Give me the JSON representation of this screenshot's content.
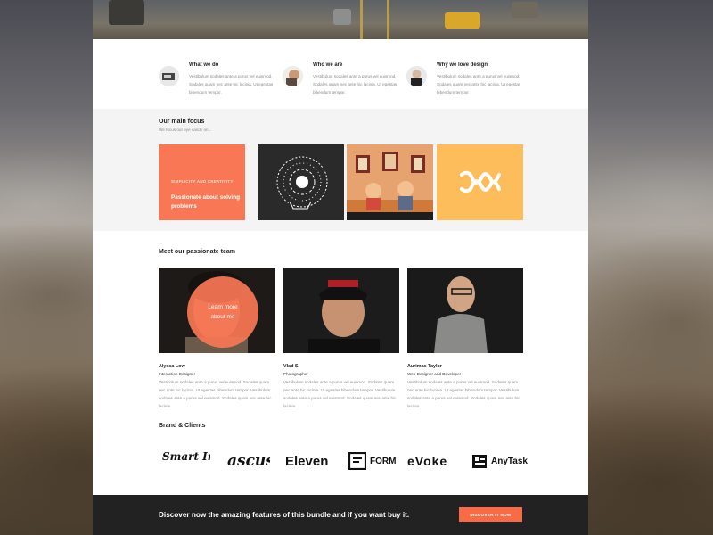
{
  "features": [
    {
      "title": "What we do",
      "text": "Vestibulum sodales ante a purus vel euismod. Sodales quam nec ante hic lacinia. Ut egestas bibendum tempor."
    },
    {
      "title": "Who we are",
      "text": "Vestibulum sodales ante a purus vel euismod. Sodales quam nec ante hic lacinia. Ut egestas bibendum tempor."
    },
    {
      "title": "Why we love design",
      "text": "Vestibulum sodales ante a purus vel euismod. Sodales quam nec ante hic lacinia. Ut egestas bibendum tempor."
    }
  ],
  "focus": {
    "title": "Our main focus",
    "subtitle": "We focus our eye candy on...",
    "tile_kicker": "SIMPLICITY AND CREATIVITY",
    "tile_headline": "Passionate about solving problems"
  },
  "team": {
    "title": "Meet our passionate team",
    "learn_more": "Learn more about me",
    "members": [
      {
        "name": "Alyssa Low",
        "role": "Interaction Designer",
        "bio": "Vestibulum sodales ante a purus vel euismod. Sodales quam nec ante hic lacinia. Ut egestas bibendum tempor. Vestibulum sodales ante a purus vel euismod. Sodales quam nec ante hic lacinia."
      },
      {
        "name": "Vlad S.",
        "role": "Photographer",
        "bio": "Vestibulum sodales ante a purus vel euismod. Sodales quam nec ante hic lacinia. Ut egestas bibendum tempor. Vestibulum sodales ante a purus vel euismod. Sodales quam nec ante hic lacinia."
      },
      {
        "name": "Aurimas Taylor",
        "role": "Web Designer and Developer",
        "bio": "Vestibulum sodales ante a purus vel euismod. Sodales quam nec ante hic lacinia. Ut egestas bibendum tempor. Vestibulum sodales ante a purus vel euismod. Sodales quam nec ante hic lacinia."
      }
    ]
  },
  "brands": {
    "title": "Brand & Clients",
    "logos": [
      "Smart Image",
      "ascus",
      "Eleven",
      "FORM",
      "eVoke",
      "AnyTask"
    ]
  },
  "cta": {
    "text": "Discover now the amazing features of this bundle and if you want buy it.",
    "button": "DISCOVER IT NOW"
  },
  "colors": {
    "accent": "#fa7755",
    "yellow": "#fdbd5a",
    "dark": "#222222"
  }
}
